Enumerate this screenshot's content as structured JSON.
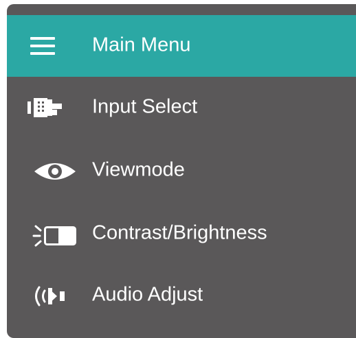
{
  "menu": {
    "header": {
      "icon": "hamburger-menu-icon",
      "title": "Main Menu",
      "background": "#2ba8a4"
    },
    "items": [
      {
        "icon": "input-connector-icon",
        "label": "Input Select"
      },
      {
        "icon": "eye-icon",
        "label": "Viewmode"
      },
      {
        "icon": "brightness-contrast-icon",
        "label": "Contrast/Brightness"
      },
      {
        "icon": "speaker-icon",
        "label": "Audio Adjust"
      }
    ],
    "panel_background": "#5a5859",
    "text_color": "#ffffff"
  }
}
